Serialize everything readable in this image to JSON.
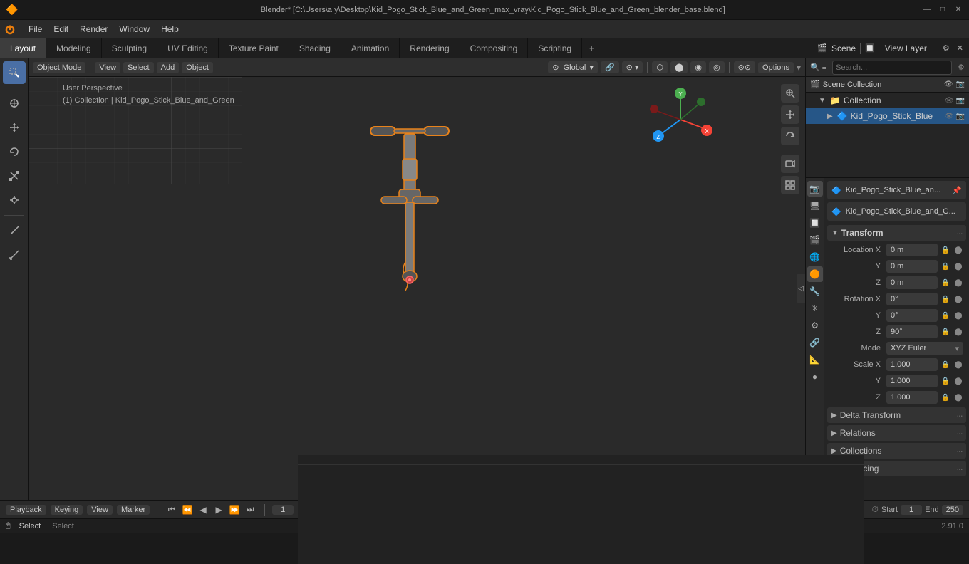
{
  "titlebar": {
    "title": "Blender* [C:\\Users\\a y\\Desktop\\Kid_Pogo_Stick_Blue_and_Green_max_vray\\Kid_Pogo_Stick_Blue_and_Green_blender_base.blend]",
    "controls": [
      "—",
      "□",
      "✕"
    ]
  },
  "menubar": {
    "items": [
      "Blender",
      "File",
      "Edit",
      "Render",
      "Window",
      "Help"
    ]
  },
  "workspace_tabs": {
    "tabs": [
      "Layout",
      "Modeling",
      "Sculpting",
      "UV Editing",
      "Texture Paint",
      "Shading",
      "Animation",
      "Rendering",
      "Compositing",
      "Scripting"
    ],
    "active": "Layout",
    "scene": "Scene",
    "view_layer": "View Layer",
    "add_icon": "+"
  },
  "viewport_header": {
    "mode": "Object Mode",
    "view": "View",
    "select": "Select",
    "add": "Add",
    "object": "Object",
    "pivot": "Global",
    "snap_icon": "🔗",
    "proportional_icon": "⊙",
    "options": "Options"
  },
  "viewport_info": {
    "perspective": "User Perspective",
    "collection": "(1) Collection | Kid_Pogo_Stick_Blue_and_Green"
  },
  "outliner": {
    "scene_collection_label": "Scene Collection",
    "items": [
      {
        "label": "Collection",
        "depth": 1,
        "icon": "📁",
        "arrow": "▼",
        "visible": true,
        "selected": false
      },
      {
        "label": "Kid_Pogo_Stick_Blue",
        "depth": 2,
        "icon": "🔷",
        "arrow": "",
        "visible": true,
        "selected": true
      }
    ]
  },
  "properties": {
    "active_object_name": "Kid_Pogo_Stick_Blue_an...",
    "active_object_data": "Kid_Pogo_Stick_Blue_and_G...",
    "sections": {
      "transform": {
        "label": "Transform",
        "location": {
          "x": "0 m",
          "y": "0 m",
          "z": "0 m"
        },
        "rotation": {
          "x": "0°",
          "y": "0°",
          "z": "90°"
        },
        "mode": "XYZ Euler",
        "scale": {
          "x": "1.000",
          "y": "1.000",
          "z": "1.000"
        }
      },
      "delta_transform": {
        "label": "Delta Transform"
      },
      "relations": {
        "label": "Relations"
      },
      "collections": {
        "label": "Collections"
      },
      "instancing": {
        "label": "Instancing"
      }
    }
  },
  "timeline": {
    "playback_label": "Playback",
    "keying_label": "Keying",
    "view_label": "View",
    "marker_label": "Marker",
    "frame_current": "1",
    "start_label": "Start",
    "start_value": "1",
    "end_label": "End",
    "end_value": "250",
    "play_controls": [
      "⏮",
      "⏪",
      "◀",
      "▶",
      "⏩",
      "⏭"
    ]
  },
  "status_bar": {
    "left_label": "Select",
    "shortcut_hint": "🖱",
    "version": "2.91.0"
  },
  "icons": {
    "cursor": "⊕",
    "move": "✥",
    "rotate": "↻",
    "scale": "⤢",
    "transform": "❇",
    "annotate": "✏",
    "measure": "📐",
    "zoom": "🔍",
    "hand": "✋",
    "camera_view": "🎥",
    "layout": "⊞",
    "snap": "🧲",
    "overlay": "⊙",
    "shading_solid": "⬤",
    "render_engine": "🔧",
    "filter": "≡",
    "lock": "🔒",
    "eye": "👁",
    "render": "📷",
    "viewport": "🖥",
    "particles": "✳",
    "physics": "⚙",
    "constraints": "🔗",
    "modifiers": "🔧",
    "object_data": "📐",
    "material": "●",
    "scene": "🎬",
    "world": "🌐",
    "object_props": "🟠"
  }
}
